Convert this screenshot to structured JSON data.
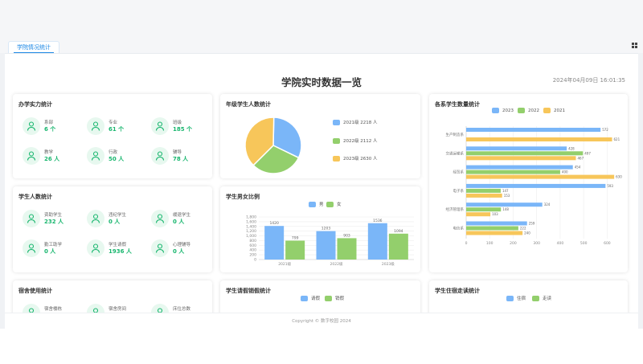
{
  "tab": {
    "label": "学院情况统计"
  },
  "header": {
    "title": "学院实时数据一览",
    "datetime": "2024年04月09日 16:01:35"
  },
  "cards": {
    "school": {
      "title": "办学实力统计",
      "items": [
        {
          "label": "系部",
          "value": "6 个",
          "icon": "org-chart-icon"
        },
        {
          "label": "专业",
          "value": "61 个",
          "icon": "book-icon"
        },
        {
          "label": "班级",
          "value": "185 个",
          "icon": "board-icon"
        },
        {
          "label": "教学",
          "value": "26 人",
          "icon": "teacher-icon"
        },
        {
          "label": "行政",
          "value": "50 人",
          "icon": "admin-icon"
        },
        {
          "label": "辅导",
          "value": "78 人",
          "icon": "counselor-icon"
        }
      ]
    },
    "students": {
      "title": "学生人数统计",
      "items": [
        {
          "label": "资助学生",
          "value": "232 人",
          "icon": "cap-icon"
        },
        {
          "label": "违纪学生",
          "value": "0 人",
          "icon": "alert-icon"
        },
        {
          "label": "缓退学生",
          "value": "0 人",
          "icon": "doc-icon"
        },
        {
          "label": "勤工助学",
          "value": "0 人",
          "icon": "badge-icon"
        },
        {
          "label": "学生请假",
          "value": "1936 人",
          "icon": "user-clock-icon"
        },
        {
          "label": "心理辅导",
          "value": "0 人",
          "icon": "heart-icon"
        }
      ]
    },
    "dorm": {
      "title": "宿舍使用统计",
      "items": [
        {
          "label": "宿舍楼栋",
          "icon": "building-icon"
        },
        {
          "label": "宿舍房间",
          "icon": "room-icon"
        },
        {
          "label": "床位总数",
          "icon": "bed-icon"
        }
      ]
    },
    "grade": {
      "title": "年级学生人数统计",
      "legend": [
        "2021级 2218 人",
        "2022级 2112 人",
        "2023级 2630 人"
      ]
    },
    "gender": {
      "title": "学生男女比例",
      "legend": [
        "男",
        "女"
      ]
    },
    "leave": {
      "title": "学生请假销假统计",
      "legend": [
        "请假",
        "销假"
      ]
    },
    "major": {
      "title": "各系学生数量统计",
      "legend": [
        "2023",
        "2022",
        "2021"
      ]
    },
    "residence": {
      "title": "学生住宿走读统计",
      "legend": [
        "住宿",
        "走读"
      ]
    }
  },
  "colors": {
    "blue": "#7ab6f8",
    "green": "#93cf6c",
    "yellow": "#f7c65a",
    "accent": "#18b66e"
  },
  "chart_data": [
    {
      "type": "pie",
      "title": "年级学生人数统计",
      "categories": [
        "2021级",
        "2022级",
        "2023级"
      ],
      "values": [
        2218,
        2112,
        2630
      ]
    },
    {
      "type": "bar",
      "title": "学生男女比例",
      "categories": [
        "2021级",
        "2022级",
        "2023级"
      ],
      "series": [
        {
          "name": "男",
          "values": [
            1420,
            1203,
            1536
          ]
        },
        {
          "name": "女",
          "values": [
            799,
            903,
            1094
          ]
        }
      ],
      "ylim": [
        0,
        1800
      ],
      "yticks": [
        0,
        200,
        400,
        600,
        800,
        "1,000",
        "1,200",
        "1,400",
        "1,600",
        "1,800"
      ]
    },
    {
      "type": "bar",
      "title": "各系学生数量统计",
      "orientation": "horizontal",
      "categories": [
        "生产制造系",
        "交通运输系",
        "经贸系",
        "电子系",
        "经济管理系",
        "电信系"
      ],
      "series": [
        {
          "name": "2023",
          "values": [
            572,
            428,
            454,
            593,
            324,
            259
          ]
        },
        {
          "name": "2022",
          "values": [
            0,
            497,
            400,
            147,
            148,
            222
          ]
        },
        {
          "name": "2021",
          "values": [
            621,
            467,
            630,
            153,
            103,
            240
          ]
        }
      ],
      "xlim": [
        0,
        650
      ],
      "xticks": [
        0,
        100,
        200,
        300,
        400,
        500,
        600
      ]
    }
  ],
  "footer": {
    "copyright": "Copyright © 数字校园 2024"
  }
}
